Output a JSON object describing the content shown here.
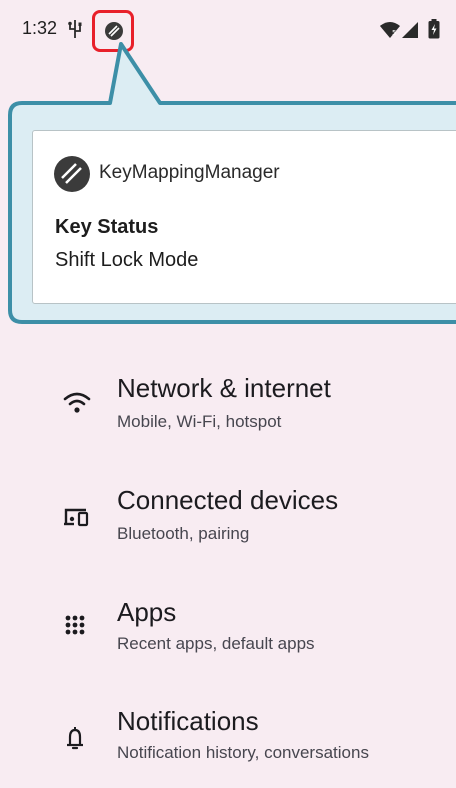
{
  "status_bar": {
    "time": "1:32",
    "icons": [
      "usb-icon",
      "key-mapping-icon",
      "wifi-icon",
      "cellular-signal-icon",
      "battery-charging-icon"
    ],
    "highlight_color": "#e8202a"
  },
  "notification": {
    "app_name": "KeyMappingManager",
    "title": "Key Status",
    "text": "Shift Lock Mode",
    "callout_color": "#3d8fa7",
    "callout_fill": "#dcedf3"
  },
  "settings": {
    "items": [
      {
        "icon": "wifi-icon",
        "title": "Network & internet",
        "subtitle": "Mobile, Wi-Fi, hotspot"
      },
      {
        "icon": "connected-devices-icon",
        "title": "Connected devices",
        "subtitle": "Bluetooth, pairing"
      },
      {
        "icon": "apps-grid-icon",
        "title": "Apps",
        "subtitle": "Recent apps, default apps"
      },
      {
        "icon": "bell-icon",
        "title": "Notifications",
        "subtitle": "Notification history, conversations"
      }
    ]
  }
}
